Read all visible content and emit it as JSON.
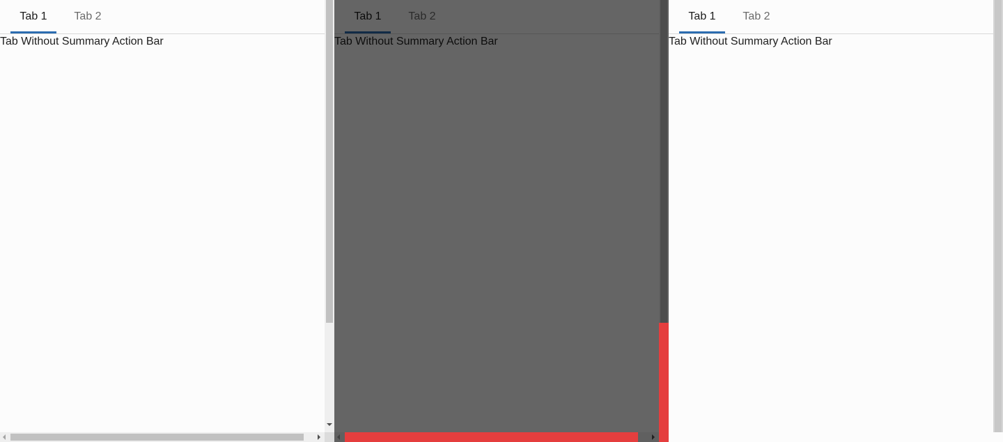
{
  "frames": [
    {
      "tabs": [
        {
          "label": "Tab 1",
          "selected": true
        },
        {
          "label": "Tab 2",
          "selected": false
        }
      ],
      "content": "Tab Without Summary Action Bar"
    },
    {
      "tabs": [
        {
          "label": "Tab 1",
          "selected": true
        },
        {
          "label": "Tab 2",
          "selected": false
        }
      ],
      "content": "Tab Without Summary Action Bar",
      "overlay": {
        "dimmed": true,
        "highlight_color": "#e53e3e",
        "highlighted": [
          "vertical-scrollbar",
          "horizontal-scrollbar"
        ]
      }
    },
    {
      "tabs": [
        {
          "label": "Tab 1",
          "selected": true
        },
        {
          "label": "Tab 2",
          "selected": false
        }
      ],
      "content": "Tab Without Summary Action Bar"
    }
  ],
  "colors": {
    "accent": "#2b6cb0",
    "background": "#fcfcfc",
    "highlight": "#e53e3e"
  }
}
